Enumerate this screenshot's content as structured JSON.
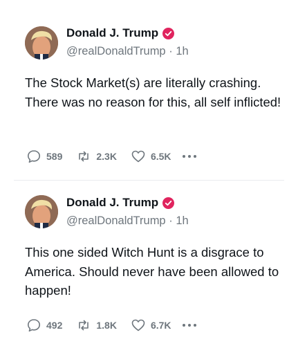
{
  "posts": [
    {
      "author_name": "Donald J. Trump",
      "handle": "@realDonaldTrump",
      "separator": "·",
      "time": "1h",
      "text": "The Stock Market(s) are literally crashing. There was no reason for this, all self inflicted!",
      "replies": "589",
      "reposts": "2.3K",
      "likes": "6.5K"
    },
    {
      "author_name": "Donald J. Trump",
      "handle": "@realDonaldTrump",
      "separator": "·",
      "time": "1h",
      "text": "This one sided Witch Hunt is a disgrace to America. Should never have been allowed to happen!",
      "replies": "492",
      "reposts": "1.8K",
      "likes": "6.7K"
    }
  ],
  "icons": {
    "verified": "verified-badge-icon",
    "reply": "reply-icon",
    "repost": "repost-icon",
    "like": "heart-icon",
    "more": "more-dots-icon"
  },
  "colors": {
    "verified_badge": "#e0245e",
    "meta_text": "#6e767d",
    "body_text": "#0f1419"
  }
}
